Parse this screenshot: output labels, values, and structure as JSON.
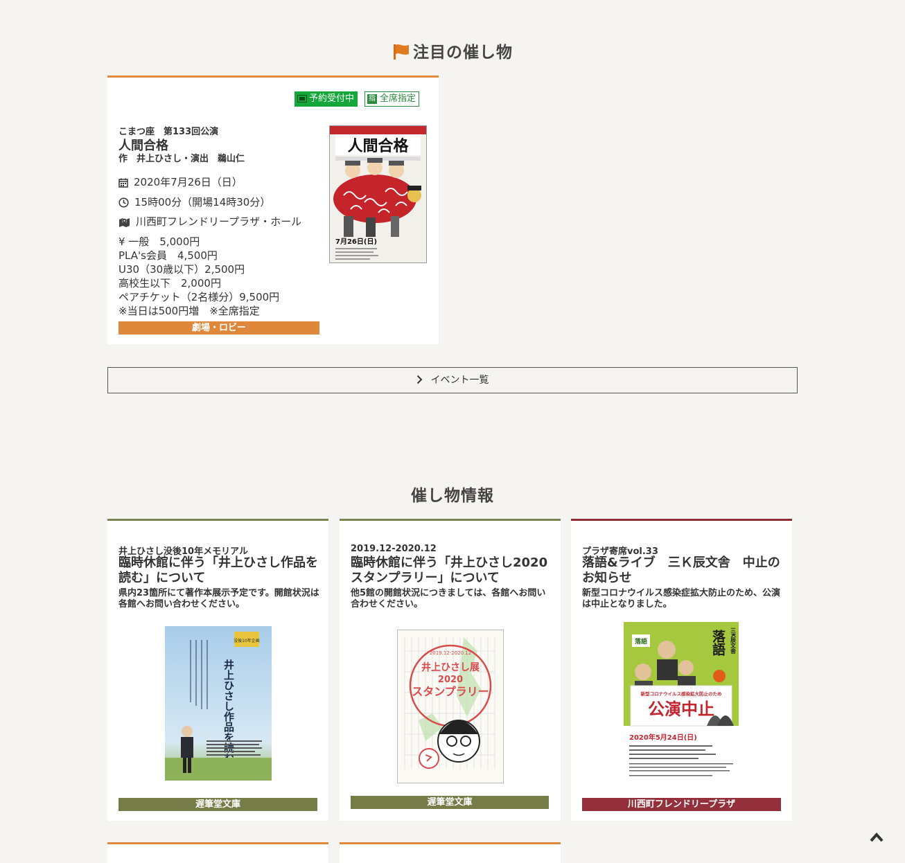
{
  "featured": {
    "heading": "注目の催し物",
    "badges": {
      "reservation": "予約受付中",
      "seat_mark": "指",
      "seat": "全席指定"
    },
    "series": "こまつ座　第133回公演",
    "title": "人間合格",
    "credit": "作　井上ひさし・演出　鵜山仁",
    "date": "2020年7月26日（日）",
    "time": "15時00分（開場14時30分）",
    "venue": "川西町フレンドリープラザ・ホール",
    "prices": [
      "¥  一般　5,000円",
      "PLA's会員　4,500円",
      "U30（30歳以下）2,500円",
      "高校生以下　2,000円",
      "ペアチケット（2名様分）9,500円",
      "※当日は500円増　※全席指定"
    ],
    "location_tag": "劇場・ロビー",
    "poster": {
      "title": "人間合格",
      "date": "7月26日(日)"
    }
  },
  "event_list_button": "イベント一覧",
  "info": {
    "heading": "催し物情報",
    "cards": [
      {
        "kicker": "井上ひさし没後10年メモリアル",
        "title": "臨時休館に伴う「井上ひさし作品を読む」について",
        "desc": "県内23箇所にて著作本展示予定です。開館状況は各館へお問い合わせください。",
        "tag": "遅筆堂文庫",
        "poster_text": "井上ひさし作品を読む",
        "poster_badge": "没後10年企画"
      },
      {
        "kicker": "2019.12-2020.12",
        "title": "臨時休館に伴う「井上ひさし2020スタンプラリー」について",
        "desc": "他5館の開館状況につきましては、各館へお問い合わせください。",
        "tag": "遅筆堂文庫",
        "poster_period": "2019.12-2020.12",
        "poster_line1": "井上ひさし展",
        "poster_line2": "2020",
        "poster_line3": "スタンプラリー"
      },
      {
        "kicker": "プラザ寄席vol.33",
        "title": "落語&ライブ　三Ｋ辰文舎　中止のお知らせ",
        "desc": "新型コロナウイルス感染症拡大防止のため、公演は中止となりました。",
        "tag": "川西町フレンドリープラザ",
        "poster_notice": "新型コロナウイルス感染拡大防止のため",
        "poster_cancel": "公演中止",
        "poster_date": "2020年5月24日(日)",
        "poster_rakugo": "落語",
        "poster_group": "三K辰文舎"
      }
    ]
  },
  "colors": {
    "accent": "#e0883a",
    "olive": "#767c47",
    "wine": "#93303b",
    "green": "#14a83a"
  }
}
